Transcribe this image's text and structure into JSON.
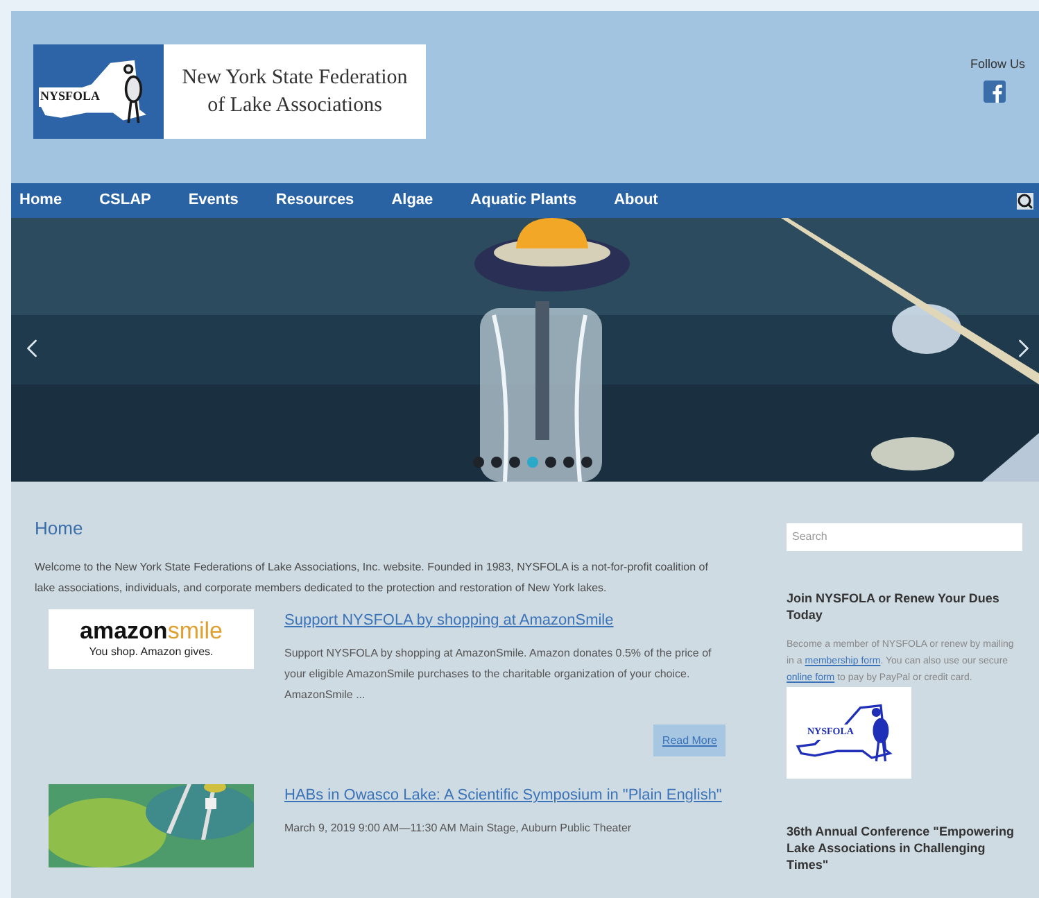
{
  "header": {
    "logo": {
      "badge": "NYSFOLA",
      "line_1": "New York State Federation",
      "line_2": "of Lake Associations"
    },
    "follow_label": "Follow Us"
  },
  "nav": {
    "items": [
      {
        "label": "Home"
      },
      {
        "label": "CSLAP"
      },
      {
        "label": "Events"
      },
      {
        "label": "Resources"
      },
      {
        "label": "Algae"
      },
      {
        "label": "Aquatic Plants"
      },
      {
        "label": "About"
      }
    ]
  },
  "slider": {
    "dots": [
      {
        "selected": false
      },
      {
        "selected": false
      },
      {
        "selected": false
      },
      {
        "selected": true
      },
      {
        "selected": false
      },
      {
        "selected": false
      },
      {
        "selected": false
      }
    ]
  },
  "main": {
    "title": "Home",
    "intro": "Welcome to the New York State Federations of Lake Associations, Inc. website. Founded in 1983, NYSFOLA is a not-for-profit coalition of lake associations, individuals, and corporate members dedicated to the protection and restoration of New York lakes.",
    "posts": [
      {
        "kind": "logo",
        "logo_word_1": "amazon",
        "logo_word_2": "smile",
        "logo_tagline": "You shop. Amazon gives.",
        "title": "Support NYSFOLA by shopping at AmazonSmile",
        "excerpt": "Support NYSFOLA by shopping at AmazonSmile. Amazon donates 0.5% of the price of your eligible AmazonSmile purchases to the charitable organization of your choice. AmazonSmile ...",
        "button": "Read More"
      },
      {
        "kind": "picture",
        "title": "HABs in Owasco Lake: A Scientific Symposium in \"Plain English\"",
        "excerpt": "March 9, 2019 9:00 AM—11:30 AM Main Stage, Auburn Public Theater"
      }
    ]
  },
  "sidebar": {
    "search": {
      "placeholder": "Search"
    },
    "join": {
      "title": "Join NYSFOLA or Renew Your Dues Today",
      "text_1": "Become a member of NYSFOLA or renew by mailing in a ",
      "link_1": "membership form",
      "text_2": ". You can also use our secure ",
      "link_2": "online form",
      "text_3": " to pay by PayPal or credit card.",
      "logo_badge": "NYSFOLA"
    },
    "conference": {
      "title": "36th Annual Conference \"Empowering Lake Associations in Challenging Times\""
    }
  }
}
